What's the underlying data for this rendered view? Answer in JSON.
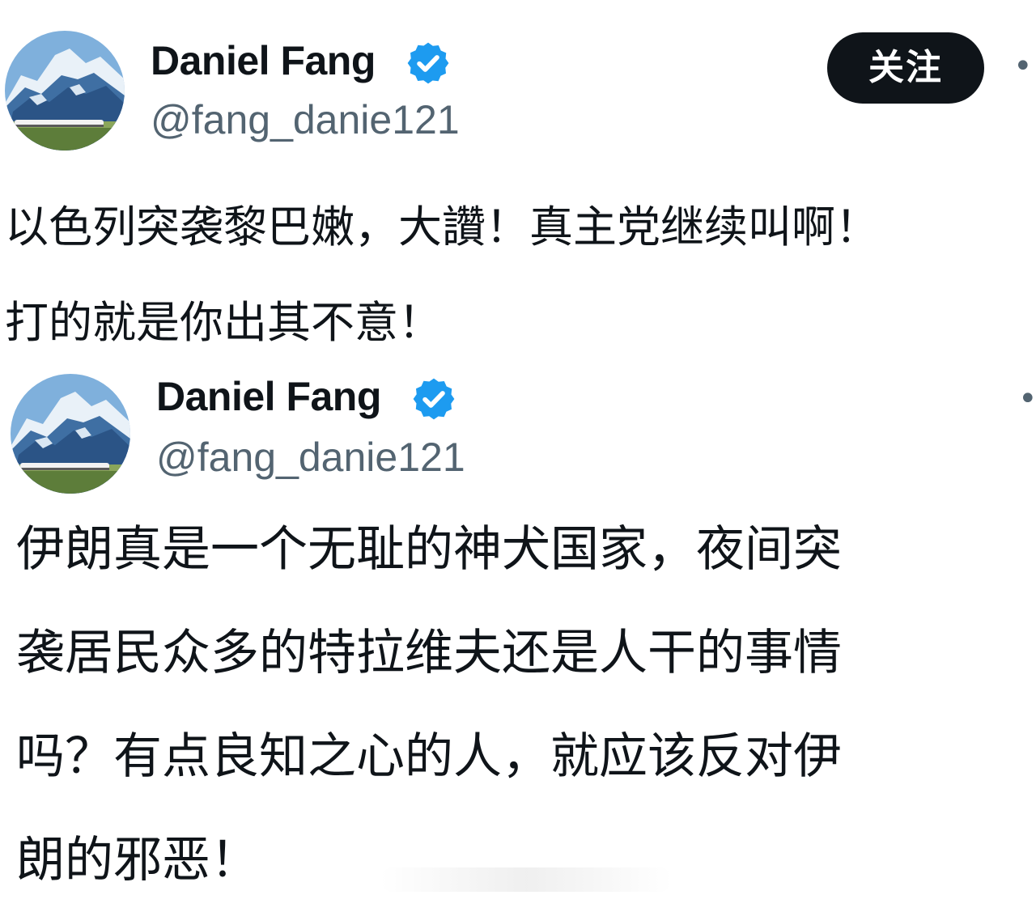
{
  "colors": {
    "text": "#0f1419",
    "secondary": "#536471",
    "verified": "#1d9bf0",
    "follow_bg": "#0f1419",
    "follow_text": "#ffffff"
  },
  "tweets": [
    {
      "author": {
        "name": "Daniel Fang",
        "handle": "@fang_danie121",
        "verified": true,
        "avatar_icon": "mountain-train-avatar"
      },
      "follow_label": "关注",
      "more_icon": "more-options-icon",
      "text_lines": [
        "以色列突袭黎巴嫩，大讚！真主党继续叫啊！",
        "打的就是你出其不意！"
      ]
    },
    {
      "author": {
        "name": "Daniel Fang",
        "handle": "@fang_danie121",
        "verified": true,
        "avatar_icon": "mountain-train-avatar"
      },
      "more_icon": "more-options-icon",
      "text_lines": [
        "伊朗真是一个无耻的神犬国家，夜间突",
        "袭居民众多的特拉维夫还是人干的事情",
        "吗？有点良知之心的人，就应该反对伊",
        "朗的邪恶！"
      ]
    }
  ]
}
